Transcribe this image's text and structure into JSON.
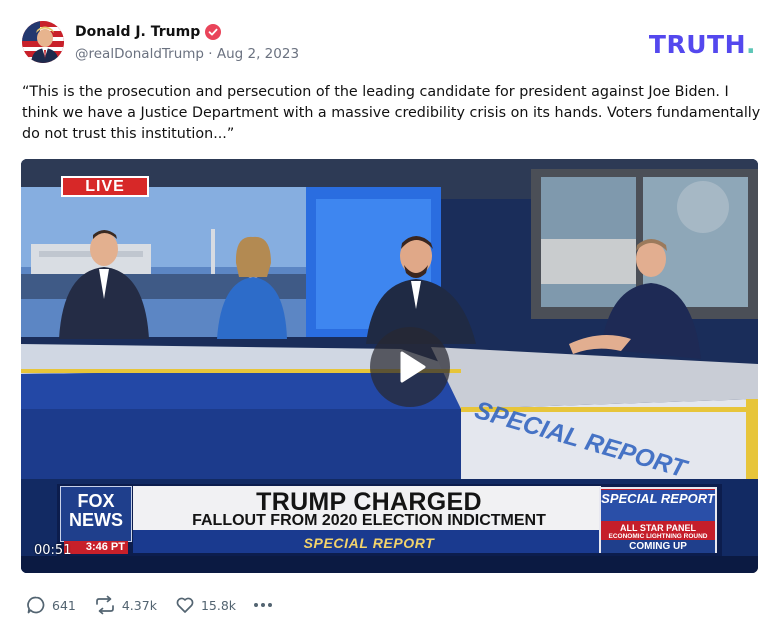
{
  "post": {
    "author_name": "Donald J. Trump",
    "handle_date": "@realDonaldTrump · Aug 2, 2023",
    "brand": "TRUTH",
    "brand_dot": ".",
    "text": "“This is the prosecution and persecution of the leading candidate for president against Joe Biden. I think we have a Justice Department with a massive credibility crisis on its hands. Voters fundamentally do not trust this institution...”"
  },
  "media": {
    "live_label": "LIVE",
    "headline": "TRUMP CHARGED",
    "subheadline": "FALLOUT FROM 2020 ELECTION INDICTMENT",
    "show_bar": "SPECIAL REPORT",
    "network_line1": "FOX",
    "network_line2": "NEWS",
    "clock": "3:46 PT",
    "promo_title": "SPECIAL REPORT",
    "promo_line1": "ALL STAR PANEL",
    "promo_line2": "ECONOMIC LIGHTNING ROUND",
    "promo_line3": "COMING UP",
    "desk_text": "SPECIAL REPORT",
    "timestamp": "00:51"
  },
  "actions": {
    "replies": "641",
    "retruths": "4.37k",
    "likes": "15.8k"
  },
  "colors": {
    "brand": "#5448ee",
    "brand_dot": "#5dc6b7",
    "verified": "#e9445a",
    "muted": "#536471"
  },
  "icons": {
    "verified": "verified-badge-icon",
    "reply": "reply-icon",
    "retruth": "retruth-icon",
    "like": "heart-icon",
    "more": "more-icon",
    "play": "play-icon"
  }
}
